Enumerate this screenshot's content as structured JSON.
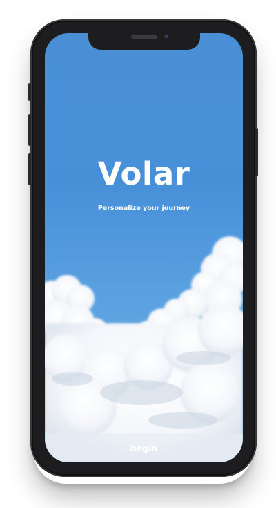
{
  "app": {
    "title": "Volar",
    "subtitle": "Personalize your journey"
  },
  "actions": {
    "begin_label": "begin"
  },
  "colors": {
    "sky_top": "#4a8fd6",
    "sky_bottom": "#78b3e6",
    "cloud": "#ffffff",
    "phone_body": "#1d1d1f",
    "button_bar": "#e6ecf4"
  },
  "device": {
    "type": "iphone-x-mockup"
  }
}
